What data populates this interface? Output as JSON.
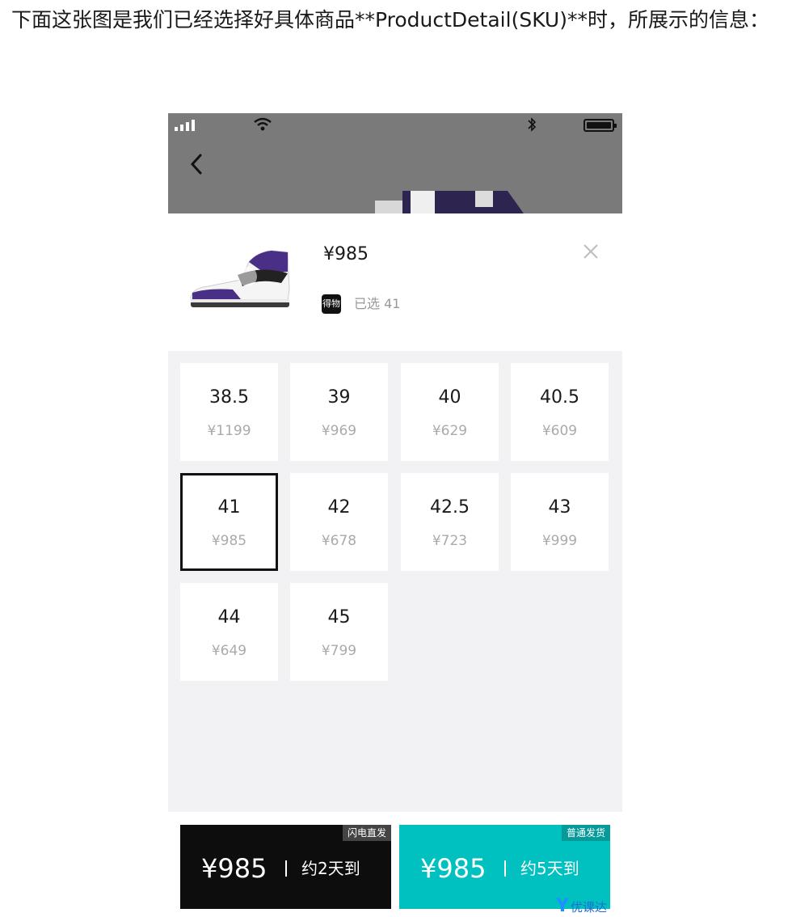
{
  "intro_text": "下面这张图是我们已经选择好具体商品**ProductDetail(SKU)**时，所展示的信息：",
  "product": {
    "price_label": "¥985",
    "brand_logo_text": "得物",
    "selected_label": "已选 41"
  },
  "sizes": [
    {
      "size": "38.5",
      "price": "¥1199",
      "selected": false
    },
    {
      "size": "39",
      "price": "¥969",
      "selected": false
    },
    {
      "size": "40",
      "price": "¥629",
      "selected": false
    },
    {
      "size": "40.5",
      "price": "¥609",
      "selected": false
    },
    {
      "size": "41",
      "price": "¥985",
      "selected": true
    },
    {
      "size": "42",
      "price": "¥678",
      "selected": false
    },
    {
      "size": "42.5",
      "price": "¥723",
      "selected": false
    },
    {
      "size": "43",
      "price": "¥999",
      "selected": false
    },
    {
      "size": "44",
      "price": "¥649",
      "selected": false
    },
    {
      "size": "45",
      "price": "¥799",
      "selected": false
    }
  ],
  "buy_options": [
    {
      "tag": "闪电直发",
      "price": "¥985",
      "eta": "约2天到",
      "color": "#0d0d0d"
    },
    {
      "tag": "普通发货",
      "price": "¥985",
      "eta": "约5天到",
      "color": "#00c0c0"
    }
  ],
  "watermark": {
    "text": "优课达"
  },
  "icons": [
    "signal-icon",
    "wifi-icon",
    "bluetooth-icon",
    "battery-icon",
    "back-chevron-icon",
    "close-icon"
  ]
}
